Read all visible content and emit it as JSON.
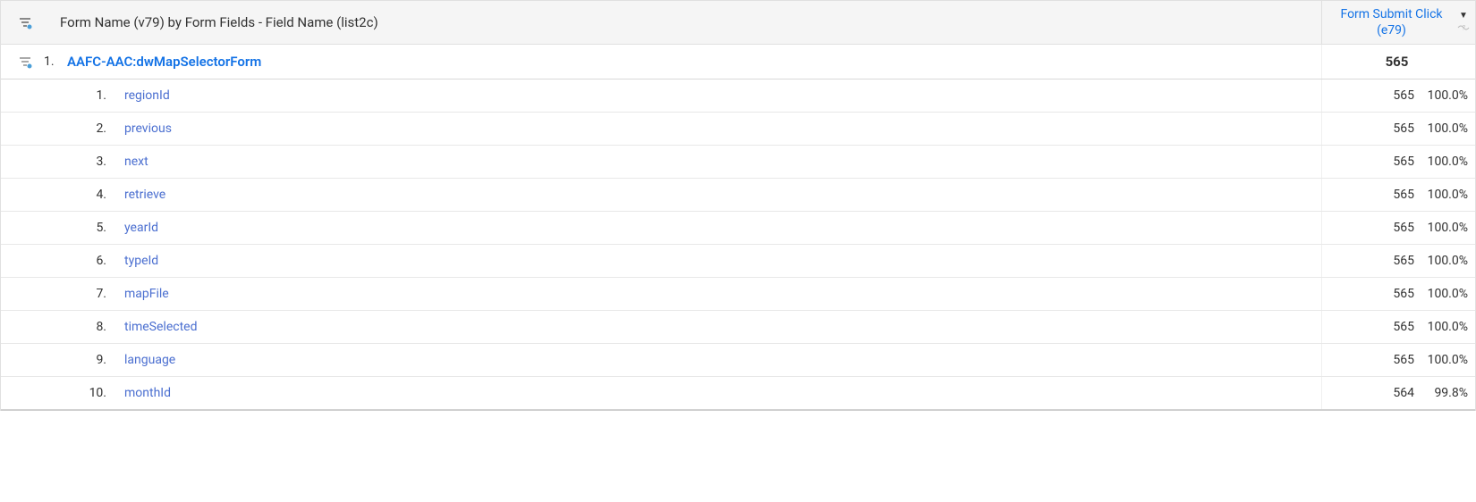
{
  "header": {
    "dimension_label": "Form Name (v79) by Form Fields - Field Name (list2c)",
    "metric_label": "Form Submit Click (e79)"
  },
  "parent": {
    "index": "1.",
    "name": "AAFC-AAC:dwMapSelectorForm",
    "value": "565"
  },
  "children": [
    {
      "index": "1.",
      "name": "regionId",
      "value": "565",
      "percent": "100.0%"
    },
    {
      "index": "2.",
      "name": "previous",
      "value": "565",
      "percent": "100.0%"
    },
    {
      "index": "3.",
      "name": "next",
      "value": "565",
      "percent": "100.0%"
    },
    {
      "index": "4.",
      "name": "retrieve",
      "value": "565",
      "percent": "100.0%"
    },
    {
      "index": "5.",
      "name": "yearId",
      "value": "565",
      "percent": "100.0%"
    },
    {
      "index": "6.",
      "name": "typeId",
      "value": "565",
      "percent": "100.0%"
    },
    {
      "index": "7.",
      "name": "mapFile",
      "value": "565",
      "percent": "100.0%"
    },
    {
      "index": "8.",
      "name": "timeSelected",
      "value": "565",
      "percent": "100.0%"
    },
    {
      "index": "9.",
      "name": "language",
      "value": "565",
      "percent": "100.0%"
    },
    {
      "index": "10.",
      "name": "monthId",
      "value": "564",
      "percent": "99.8%"
    }
  ]
}
